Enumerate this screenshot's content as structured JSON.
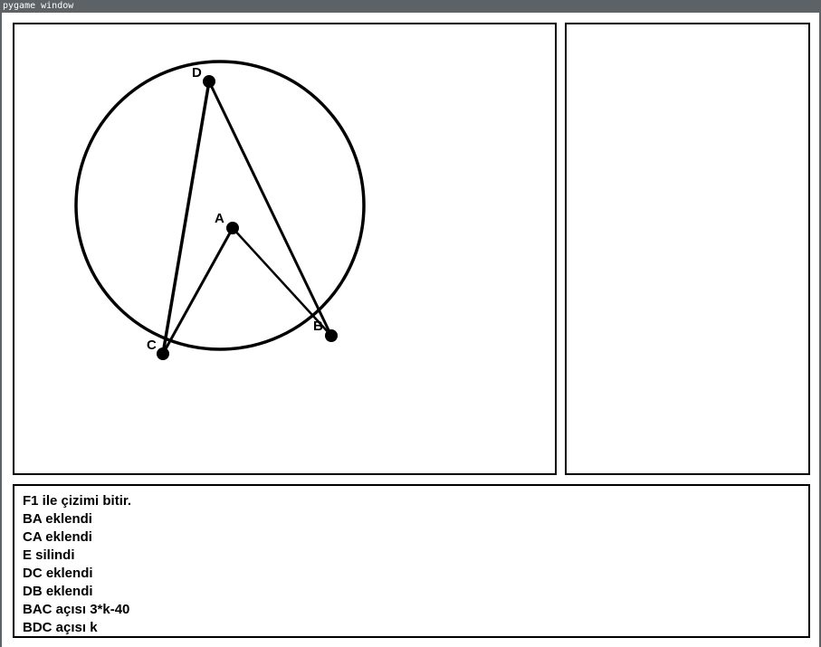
{
  "window": {
    "title": "pygame window"
  },
  "geometry": {
    "circle_center_point": "A",
    "points": [
      {
        "label": "A"
      },
      {
        "label": "B"
      },
      {
        "label": "C"
      },
      {
        "label": "D"
      }
    ],
    "segments": [
      "BA",
      "CA",
      "DC",
      "DB"
    ]
  },
  "log": {
    "lines": [
      "F1 ile çizimi bitir.",
      "BA eklendi",
      "CA eklendi",
      "E silindi",
      "DC eklendi",
      "DB eklendi",
      "BAC açısı 3*k-40",
      "BDC açısı k"
    ]
  },
  "colors": {
    "titlebar": "#5d6266",
    "ink": "#000000",
    "background": "#ffffff"
  }
}
